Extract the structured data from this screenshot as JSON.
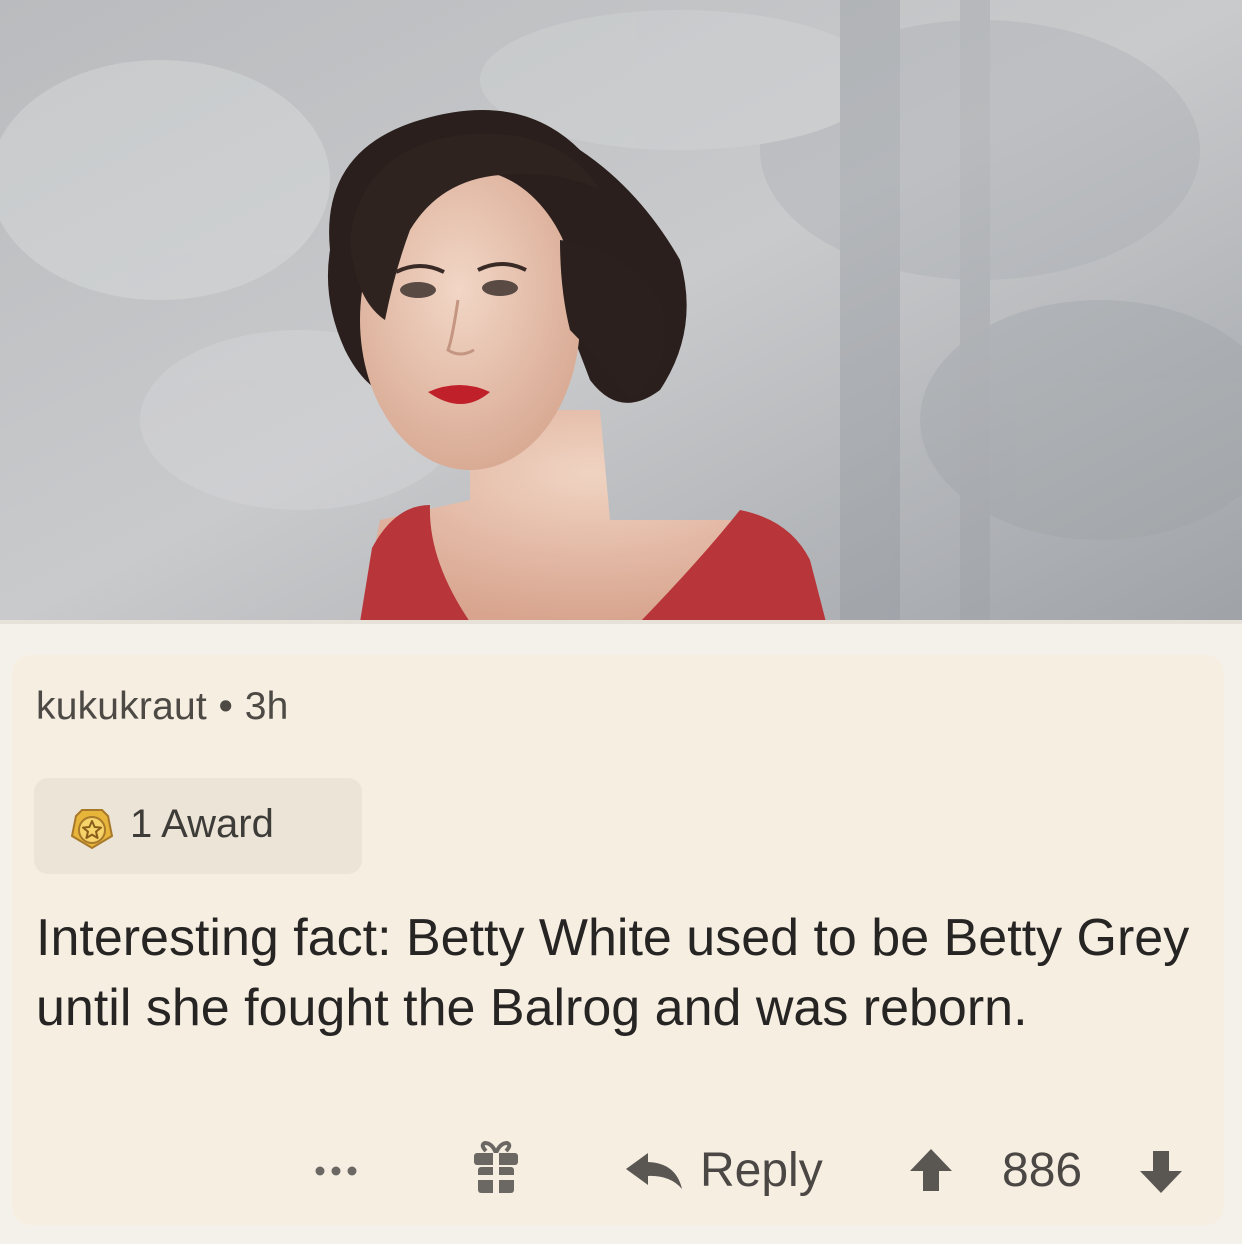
{
  "post": {
    "image_alt": "Vintage portrait of Betty White in a red dress"
  },
  "comment": {
    "username": "kukukraut",
    "separator": "•",
    "age": "3h",
    "award_label": "1 Award",
    "body": "Interesting fact: Betty White used to be Betty Grey until she fought the Balrog and was reborn.",
    "actions": {
      "reply_label": "Reply",
      "score": "886"
    }
  },
  "icons": {
    "award": "award-star-icon",
    "more": "more-options-icon",
    "gift": "gift-icon",
    "reply": "reply-arrow-icon",
    "upvote": "upvote-arrow-icon",
    "downvote": "downvote-arrow-icon"
  },
  "colors": {
    "card_background": "#f7eee2",
    "award_pill": "#ece4d6",
    "text_primary": "#262524",
    "text_muted": "#4d4a46",
    "dress": "#b8353a",
    "lipstick": "#c0202a"
  }
}
